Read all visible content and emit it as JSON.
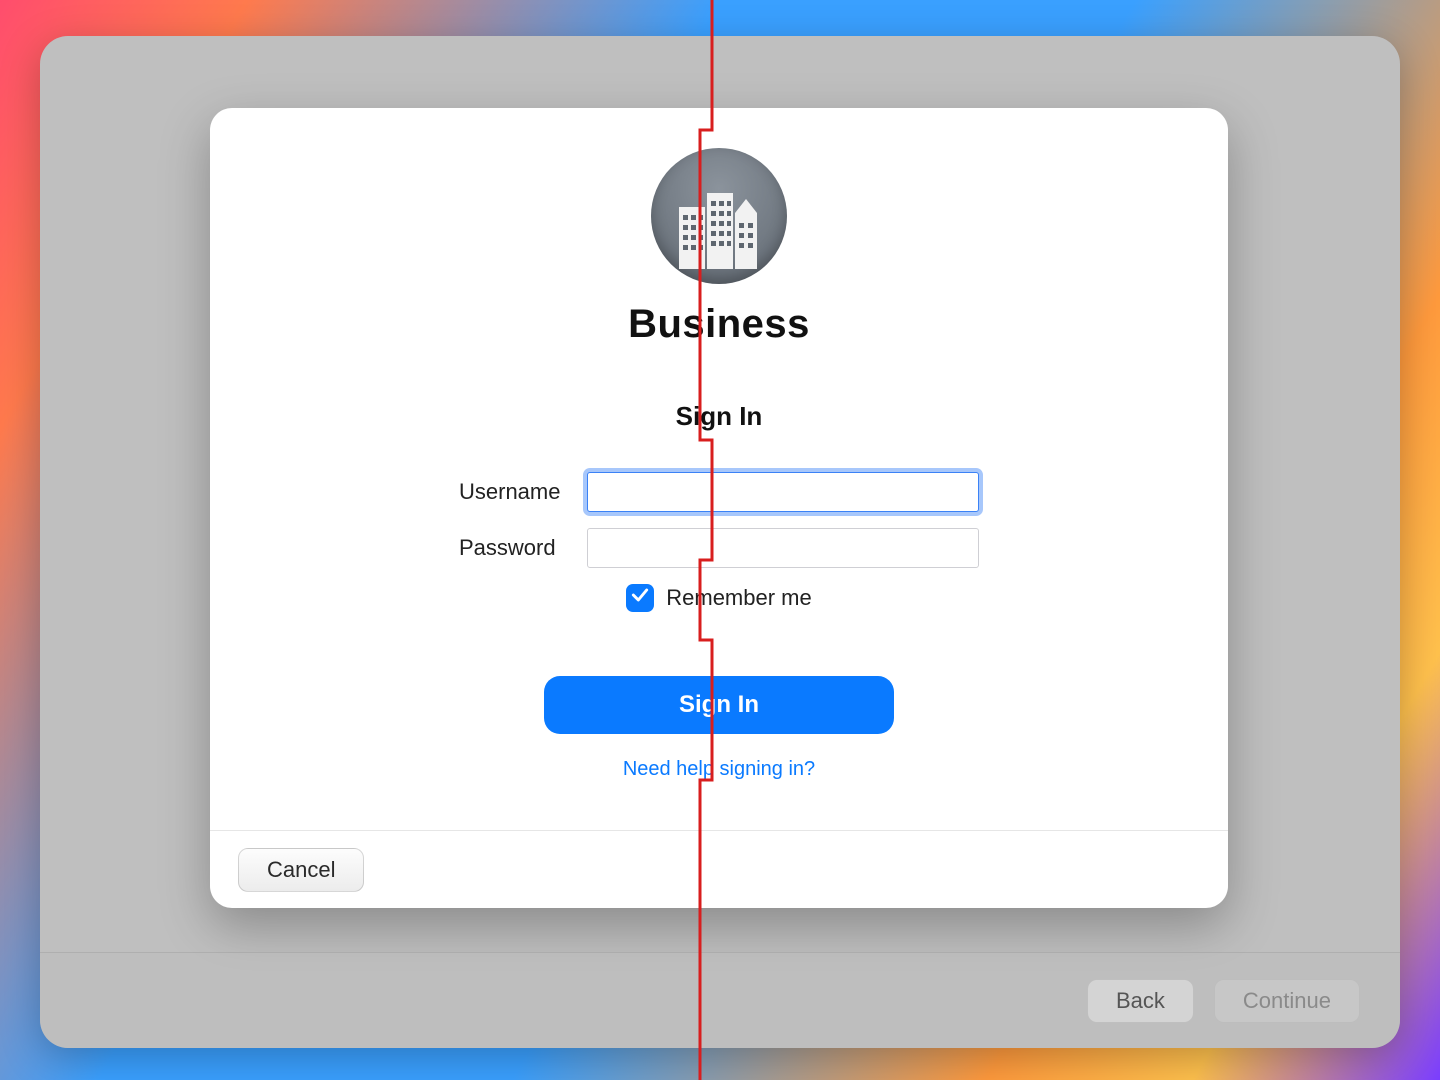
{
  "brand": "Business",
  "signin": {
    "title": "Sign In",
    "username_label": "Username",
    "password_label": "Password",
    "username_value": "",
    "password_value": "",
    "remember_label": "Remember me",
    "submit_label": "Sign In",
    "help_label": "Need help signing in?"
  },
  "sheet_footer": {
    "cancel_label": "Cancel"
  },
  "outer_footer": {
    "back_label": "Back",
    "continue_label": "Continue"
  }
}
